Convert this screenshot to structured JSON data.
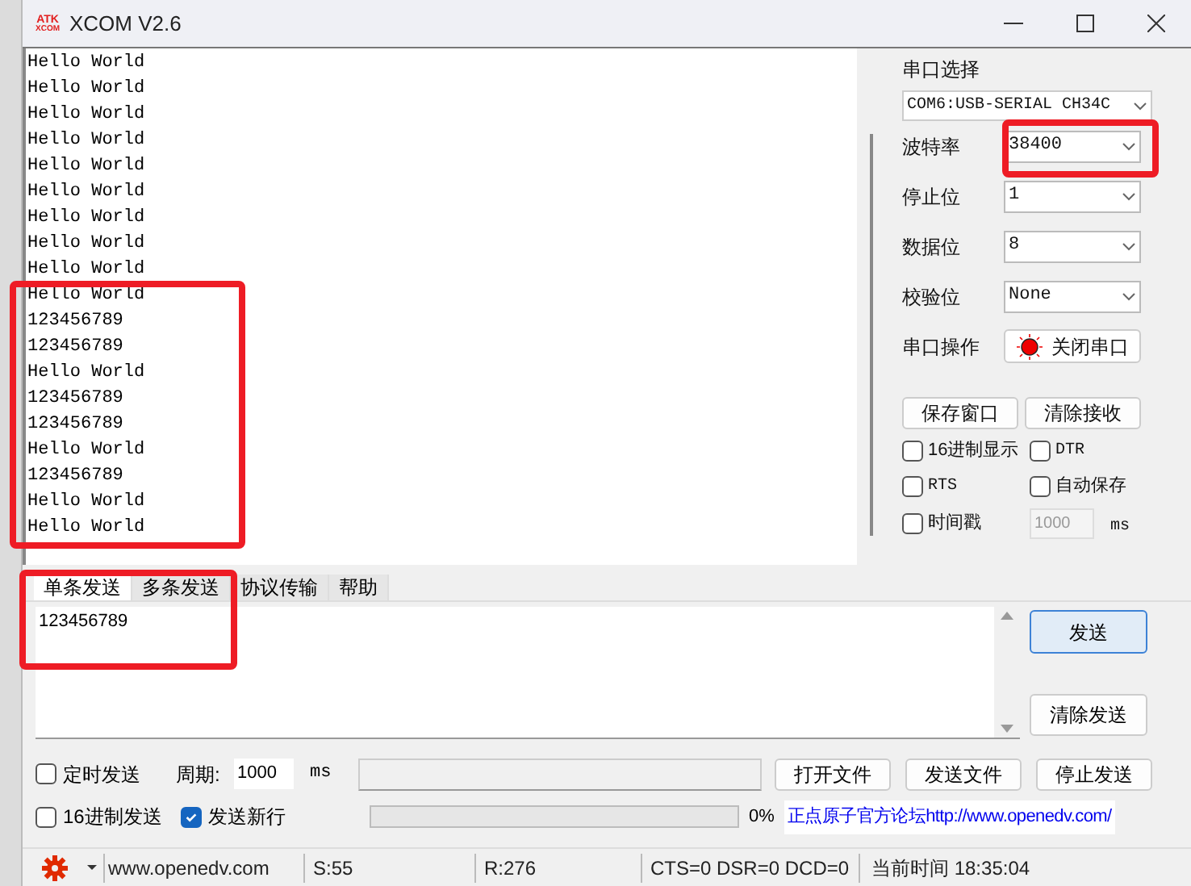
{
  "window": {
    "title": "XCOM V2.6",
    "logo": [
      "ATK",
      "XCOM"
    ]
  },
  "receive": {
    "lines": [
      "Hello World",
      "Hello World",
      "Hello World",
      "Hello World",
      "Hello World",
      "Hello World",
      "Hello World",
      "Hello World",
      "Hello World",
      "Hello World",
      "123456789",
      "123456789",
      "Hello World",
      "123456789",
      "123456789",
      "Hello World",
      "123456789",
      "Hello World",
      "Hello World"
    ]
  },
  "settings": {
    "port_label": "串口选择",
    "port": "COM6:USB-SERIAL CH34C",
    "fields": [
      {
        "label": "波特率",
        "value": "38400"
      },
      {
        "label": "停止位",
        "value": "1"
      },
      {
        "label": "数据位",
        "value": "8"
      },
      {
        "label": "校验位",
        "value": "None"
      }
    ],
    "operation_label": "串口操作",
    "operation_button": "关闭串口",
    "port_open": true,
    "buttons": [
      "保存窗口",
      "清除接收"
    ],
    "options": [
      {
        "label": "16进制显示",
        "checked": false
      },
      {
        "label": "DTR",
        "checked": false
      },
      {
        "label": "RTS",
        "checked": false
      },
      {
        "label": "自动保存",
        "checked": false
      },
      {
        "label": "时间戳",
        "checked": false
      }
    ],
    "timestamp_value": "1000",
    "timestamp_unit": "ms"
  },
  "tabs": [
    {
      "label": "单条发送",
      "selected": true
    },
    {
      "label": "多条发送",
      "selected": false
    },
    {
      "label": "协议传输",
      "selected": false
    },
    {
      "label": "帮助",
      "selected": false
    }
  ],
  "send": {
    "value": "123456789",
    "send_button": "发送",
    "clear_button": "清除发送"
  },
  "controls": {
    "timed_send": {
      "label": "定时发送",
      "checked": false
    },
    "period_label": "周期:",
    "period_value": "1000",
    "period_unit": "ms",
    "hex_send": {
      "label": "16进制发送",
      "checked": false
    },
    "newline": {
      "label": "发送新行",
      "checked": true
    },
    "file_buttons": [
      "打开文件",
      "发送文件",
      "停止发送"
    ],
    "progress": {
      "level": 0,
      "reading": "0%"
    },
    "link": "正点原子官方论坛http://www.openedv.com/"
  },
  "status_bar": {
    "website": "www.openedv.com",
    "sent": "S:55",
    "received": "R:276",
    "lines": "CTS=0 DSR=0 DCD=0",
    "time": "当前时间 18:35:04"
  },
  "annotations": [
    {
      "kind": "frame",
      "color": "#ee1c25"
    },
    {
      "kind": "frame",
      "color": "#ee1c25"
    },
    {
      "kind": "frame",
      "color": "#ee1c25"
    }
  ]
}
